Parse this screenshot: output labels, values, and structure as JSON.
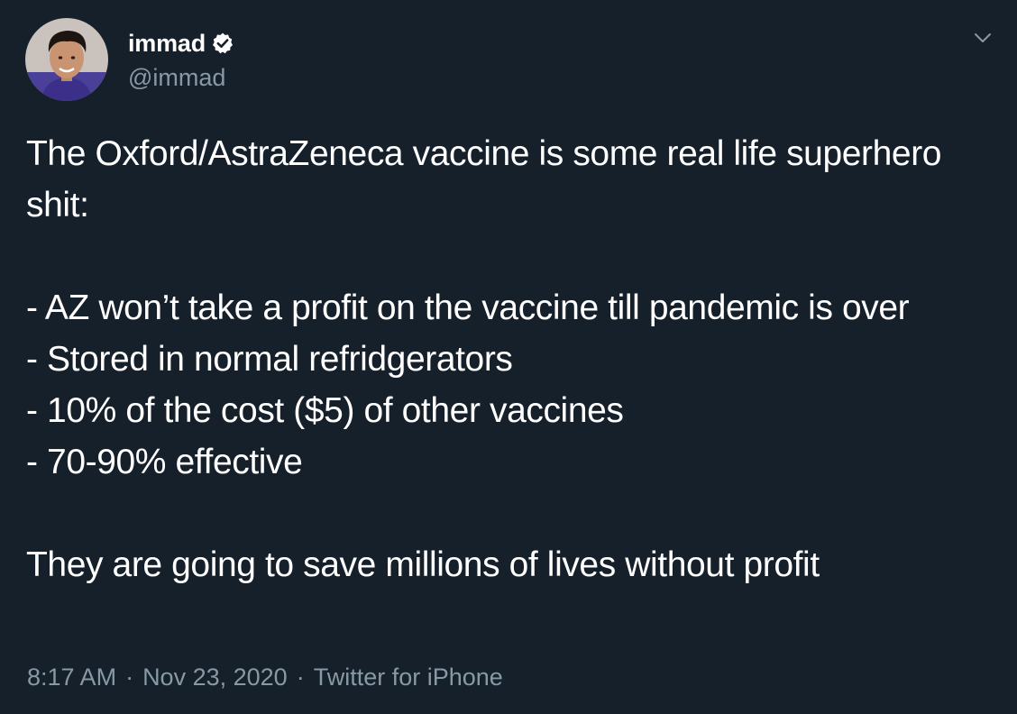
{
  "author": {
    "display_name": "immad",
    "handle": "@immad",
    "verified": true,
    "avatar_icon": "user-avatar"
  },
  "tweet": {
    "line_1": "The Oxford/AstraZeneca vaccine is some real life superhero shit:",
    "bullets": [
      "- AZ won’t take a profit on the vaccine till pandemic is over",
      "- Stored in normal refridgerators",
      "- 10% of the cost ($5) of other vaccines",
      "- 70-90% effective"
    ],
    "closing": "They are going to save millions of lives without profit"
  },
  "meta": {
    "time": "8:17 AM",
    "separator": "·",
    "date": "Nov 23, 2020",
    "source": "Twitter for iPhone"
  },
  "colors": {
    "background": "#15202b",
    "text_primary": "#ffffff",
    "text_secondary": "#8899a6"
  },
  "icons": {
    "verified": "verified-badge-icon",
    "menu": "chevron-down-icon"
  }
}
